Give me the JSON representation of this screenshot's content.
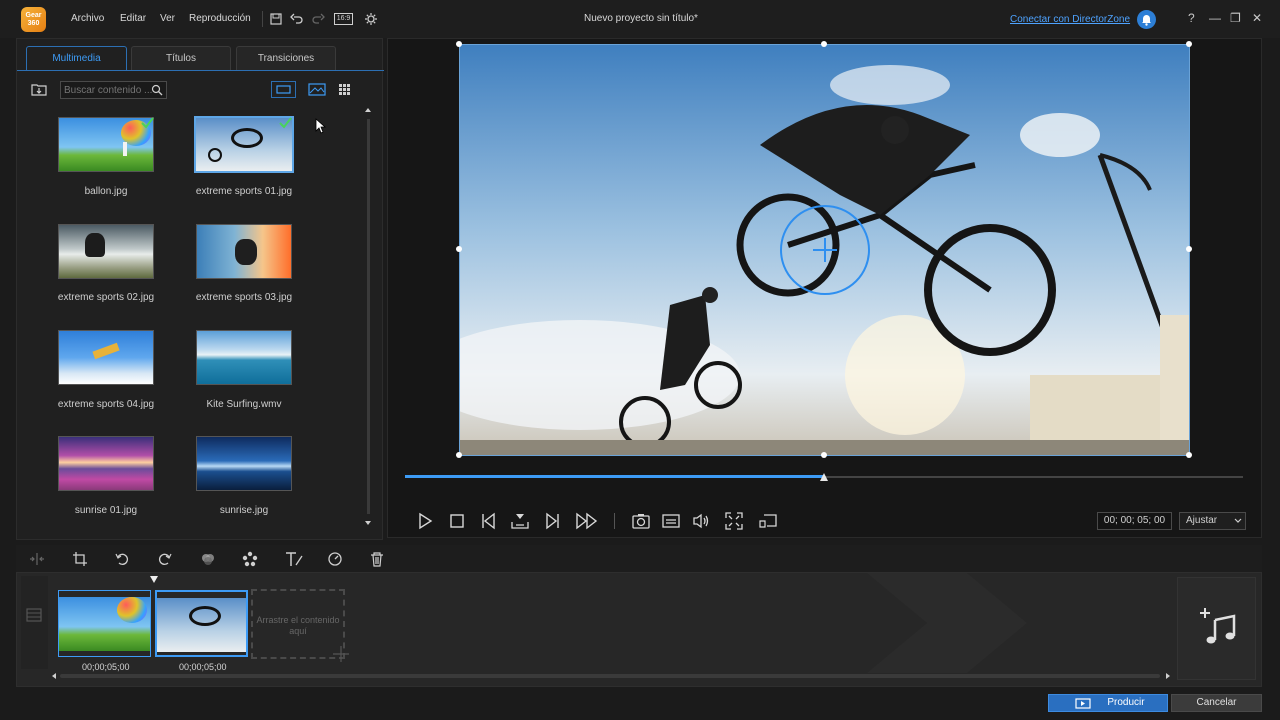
{
  "app": {
    "logo_text": "Gear 360",
    "title": "Nuevo proyecto sin título*",
    "connect_link": "Conectar con DirectorZone"
  },
  "menu": [
    "Archivo",
    "Editar",
    "Ver",
    "Reproducción"
  ],
  "toolbar": {
    "aspect_ratio": "16:9"
  },
  "window_controls": {
    "help": "?",
    "minimize": "—",
    "restore": "❐",
    "close": "✕"
  },
  "library": {
    "tabs": [
      "Multimedia",
      "Títulos",
      "Transiciones"
    ],
    "active_tab": "Multimedia",
    "search_placeholder": "Buscar contenido ...",
    "items": [
      {
        "label": "ballon.jpg",
        "checked": true,
        "selected": false
      },
      {
        "label": "extreme sports 01.jpg",
        "checked": true,
        "selected": true
      },
      {
        "label": "extreme sports 02.jpg",
        "checked": false,
        "selected": false
      },
      {
        "label": "extreme sports 03.jpg",
        "checked": false,
        "selected": false
      },
      {
        "label": "extreme sports 04.jpg",
        "checked": false,
        "selected": false
      },
      {
        "label": "Kite Surfing.wmv",
        "checked": false,
        "selected": false
      },
      {
        "label": "sunrise 01.jpg",
        "checked": false,
        "selected": false
      },
      {
        "label": "sunrise.jpg",
        "checked": false,
        "selected": false
      }
    ]
  },
  "player": {
    "timecode": "00; 00; 05; 00",
    "fit": "Ajustar",
    "progress": 0.5
  },
  "timeline": {
    "clips": [
      {
        "duration": "00;00;05;00"
      },
      {
        "duration": "00;00;05;00"
      }
    ],
    "dropzone_text": "Arrastre el contenido aquí"
  },
  "footer": {
    "produce": "Producir",
    "cancel": "Cancelar"
  },
  "colors": {
    "accent": "#3d9bf5",
    "produce_bg": "#2a6fc0",
    "background": "#1b1b1b"
  }
}
